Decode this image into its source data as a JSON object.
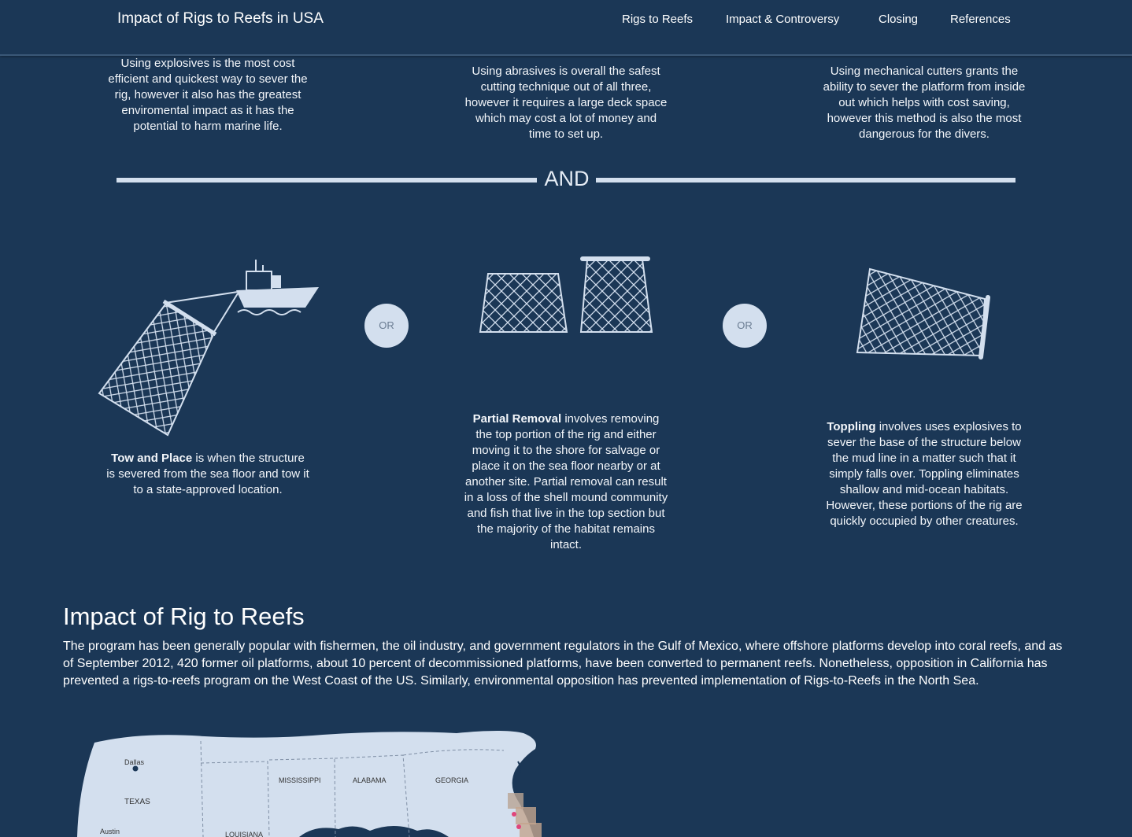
{
  "nav": {
    "brand": "Impact of Rigs to Reefs in USA",
    "links": [
      "Rigs to Reefs",
      "Impact & Controversy",
      "Closing",
      "References"
    ]
  },
  "cutting": [
    "Using explosives is the most cost efficient and quickest way to sever the rig, however it also has the greatest enviromental impact as it has the potential to harm marine life.",
    "Using abrasives is overall the safest cutting technique out of all three, however it requires a large deck space which may cost a lot of money and time to set up.",
    "Using mechanical cutters grants the ability to sever the platform from inside out which helps with cost saving, however this method is also the most dangerous for the divers."
  ],
  "divider": {
    "label": "AND"
  },
  "or_label": "OR",
  "methods": [
    {
      "name": "Tow and Place",
      "text": " is when the structure is severed from the sea floor and tow it to a state-approved location."
    },
    {
      "name": "Partial Removal",
      "text": " involves removing the top portion of the rig and either moving it to the shore for salvage or place it on the sea floor nearby or at another site. Partial removal can result in a loss of the shell mound community and fish that live in the top section but the majority of the habitat remains intact."
    },
    {
      "name": "Toppling",
      "text": " involves uses explosives to sever the base of the structure below the mud line in a matter such that it simply falls over. Toppling eliminates shallow and mid-ocean habitats. However, these portions of the rig are quickly occupied by other creatures."
    }
  ],
  "impact": {
    "title": "Impact of Rig to Reefs",
    "body": "The program has been generally popular with fishermen, the oil industry, and government regulators in the Gulf of Mexico, where offshore platforms develop into coral reefs, and as of September 2012, 420 former oil platforms, about 10 percent of decommissioned platforms, have been converted to permanent reefs. Nonetheless, opposition in California has prevented a rigs-to-reefs program on the West Coast of the US. Similarly, environmental opposition has prevented implementation of Rigs-to-Reefs in the North Sea."
  },
  "map": {
    "labels": {
      "dallas": "Dallas",
      "texas": "TEXAS",
      "austin": "Austin",
      "mississippi": "MISSISSIPPI",
      "alabama": "ALABAMA",
      "georgia": "GEORGIA",
      "louisiana": "LOUISIANA"
    },
    "colors": {
      "land": "#d3dfee",
      "ocean": "#1b3756",
      "marker": "#e0457b"
    }
  },
  "colors": {
    "background": "#1b3756",
    "accent": "#d3dfee"
  },
  "icons": [
    "ship-icon",
    "net-icon",
    "rig-section-icon",
    "toppled-rig-icon"
  ]
}
